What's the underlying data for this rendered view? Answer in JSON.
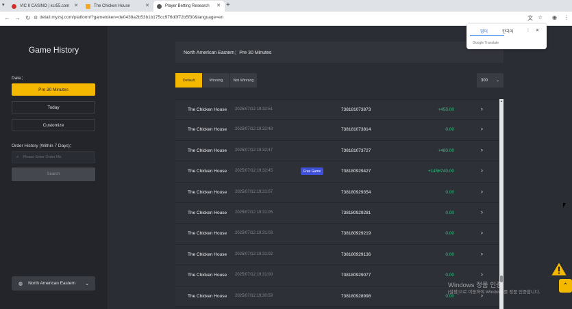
{
  "browser": {
    "tabs": [
      {
        "title": "VIC II CASINO | kcr55.com",
        "favicon_color": "#d32f2f"
      },
      {
        "title": "The Chicken House",
        "favicon_color": "#f5a623"
      },
      {
        "title": "Player Betting Research",
        "favicon_color": "#555555"
      }
    ],
    "url": "detail.myzsj.com/platform/?gametoken=de0438a2b53b1b175cc976d0f72b5f30&language=en"
  },
  "translate_popup": {
    "lang_active": "영어",
    "lang_other": "한국어",
    "footer": "Google Translate"
  },
  "sidebar": {
    "title": "Game History",
    "date_label": "Date：",
    "date_buttons": [
      "Pre 30 Minutes",
      "Today",
      "Customize"
    ],
    "order_label": "Order History (Within 7 Days)：",
    "order_placeholder": "Please Enter Order No.",
    "search_label": "Search",
    "timezone": "North American Eastern"
  },
  "main": {
    "header": "North American Eastern：Pre 30 Minutes",
    "filters": [
      "Default",
      "Winning",
      "Not Winning"
    ],
    "page_size": "300",
    "rows": [
      {
        "name": "The Chicken House",
        "time": "2025/07/12 19:32:51",
        "badge": "",
        "order": "738181073873",
        "amount": "+450.00"
      },
      {
        "name": "The Chicken House",
        "time": "2025/07/12 19:32:48",
        "badge": "",
        "order": "738181073814",
        "amount": "0.00"
      },
      {
        "name": "The Chicken House",
        "time": "2025/07/12 19:32:47",
        "badge": "",
        "order": "738181073727",
        "amount": "+480.00"
      },
      {
        "name": "The Chicken House",
        "time": "2025/07/12 19:32:45",
        "badge": "Free Game",
        "order": "738180929427",
        "amount": "+1456740.00"
      },
      {
        "name": "The Chicken House",
        "time": "2025/07/12 19:31:07",
        "badge": "",
        "order": "738180929354",
        "amount": "0.00"
      },
      {
        "name": "The Chicken House",
        "time": "2025/07/12 19:31:05",
        "badge": "",
        "order": "738180929281",
        "amount": "0.00"
      },
      {
        "name": "The Chicken House",
        "time": "2025/07/12 19:31:03",
        "badge": "",
        "order": "738180929219",
        "amount": "0.00"
      },
      {
        "name": "The Chicken House",
        "time": "2025/07/12 19:31:02",
        "badge": "",
        "order": "738180929136",
        "amount": "0.00"
      },
      {
        "name": "The Chicken House",
        "time": "2025/07/12 19:31:00",
        "badge": "",
        "order": "738180929077",
        "amount": "0.00"
      },
      {
        "name": "The Chicken House",
        "time": "2025/07/12 19:30:59",
        "badge": "",
        "order": "738180928998",
        "amount": "0.00"
      }
    ]
  },
  "windows_watermark": {
    "line1": "Windows 정품 인증",
    "line2": "[설정]으로 이동하여 Windows를 정품 인증합니다."
  },
  "colors": {
    "accent": "#f5b800",
    "win": "#2ec27e",
    "badge": "#3f51d9"
  }
}
